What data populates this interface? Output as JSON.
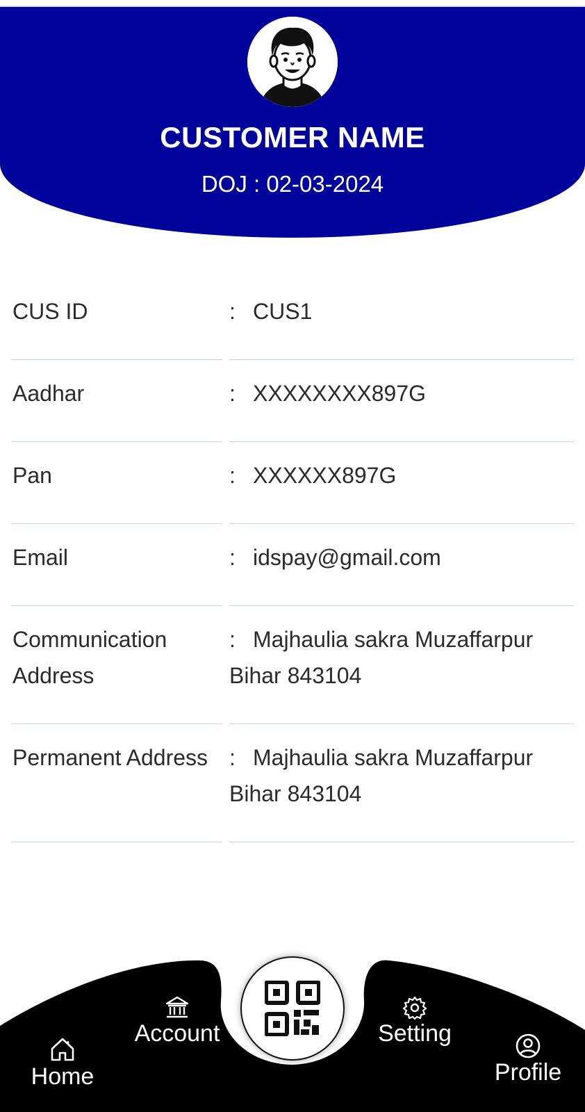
{
  "header": {
    "customer_name": "CUSTOMER NAME",
    "doj": "DOJ : 02-03-2024",
    "background_color": "#000399"
  },
  "details": [
    {
      "label": "CUS ID",
      "colon": ":",
      "value": "CUS1"
    },
    {
      "label": "Aadhar",
      "colon": ":",
      "value": "XXXXXXXX897G"
    },
    {
      "label": "Pan",
      "colon": ":",
      "value": "XXXXXX897G"
    },
    {
      "label": "Email",
      "colon": ":",
      "value": "idspay@gmail.com"
    },
    {
      "label": "Communication Address",
      "colon": ":",
      "value": "Majhaulia sakra Muzaffarpur Bihar 843104"
    },
    {
      "label": "Permanent Address",
      "colon": ":",
      "value": "Majhaulia sakra Muzaffarpur Bihar 843104"
    }
  ],
  "nav": {
    "home": {
      "label": "Home",
      "icon": "home-icon"
    },
    "account": {
      "label": "Account",
      "icon": "bank-icon"
    },
    "scan": {
      "icon": "qr-code-icon"
    },
    "setting": {
      "label": "Setting",
      "icon": "gear-icon"
    },
    "profile": {
      "label": "Profile",
      "icon": "user-circle-icon"
    },
    "background_color": "#000000"
  }
}
